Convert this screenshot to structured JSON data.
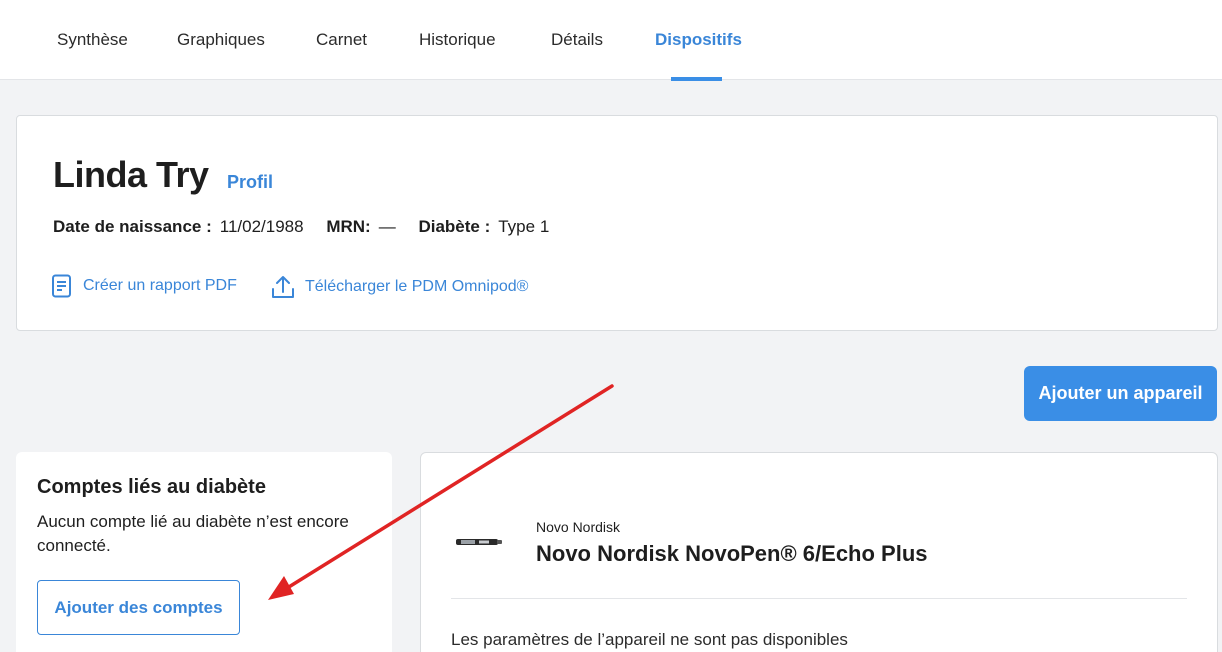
{
  "nav": {
    "tabs": [
      {
        "label": "Synthèse"
      },
      {
        "label": "Graphiques"
      },
      {
        "label": "Carnet"
      },
      {
        "label": "Historique"
      },
      {
        "label": "Détails"
      },
      {
        "label": "Dispositifs",
        "active": true
      }
    ]
  },
  "patient": {
    "name": "Linda Try",
    "profile_link": "Profil",
    "dob_label": "Date de naissance :",
    "dob_value": "11/02/1988",
    "mrn_label": "MRN:",
    "mrn_value": "—",
    "diabetes_label": "Diabète :",
    "diabetes_value": "Type 1",
    "actions": {
      "pdf_report": "Créer un rapport PDF",
      "upload_pdm": "Télécharger le PDM Omnipod®"
    }
  },
  "devices": {
    "add_device_button": "Ajouter un appareil"
  },
  "linked_accounts": {
    "title": "Comptes liés au diabète",
    "empty_text": "Aucun compte lié au diabète n’est encore connecté.",
    "add_button": "Ajouter des comptes"
  },
  "device_card": {
    "brand": "Novo Nordisk",
    "name": "Novo Nordisk NovoPen® 6/Echo Plus",
    "settings_note": "Les paramètres de l’appareil ne sont pas disponibles"
  },
  "colors": {
    "accent": "#3a8ee6",
    "link": "#3a86d8",
    "annotation_arrow": "#e02424"
  }
}
